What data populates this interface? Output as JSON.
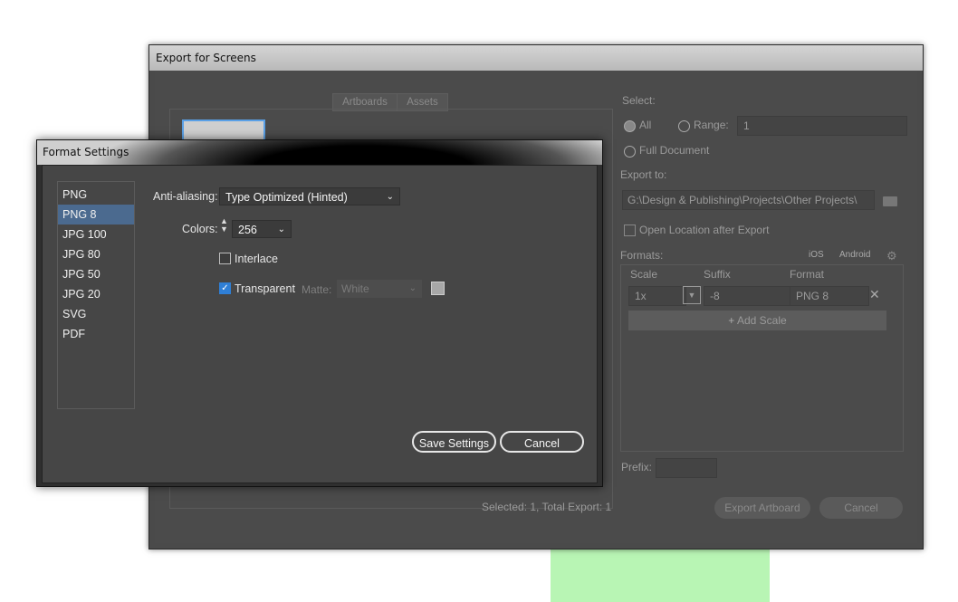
{
  "export_window": {
    "title": "Export for Screens",
    "tabs": [
      "Artboards",
      "Assets"
    ],
    "select_label": "Select:",
    "radio_all": "All",
    "radio_range": "Range:",
    "range_value": "1",
    "radio_full": "Full Document",
    "export_to_label": "Export to:",
    "export_path": "G:\\Design & Publishing\\Projects\\Other Projects\\",
    "open_location": "Open Location after Export",
    "formats_label": "Formats:",
    "ios": "iOS",
    "android": "Android",
    "col_scale": "Scale",
    "col_suffix": "Suffix",
    "col_format": "Format",
    "row_scale": "1x",
    "row_suffix": "-8",
    "row_format": "PNG 8",
    "add_scale": "Add Scale",
    "prefix_label": "Prefix:",
    "status": "Selected: 1, Total Export: 1",
    "export_button": "Export Artboard",
    "cancel_button": "Cancel"
  },
  "format_dialog": {
    "title": "Format Settings",
    "formats": [
      "PNG",
      "PNG 8",
      "JPG 100",
      "JPG 80",
      "JPG 50",
      "JPG 20",
      "SVG",
      "PDF"
    ],
    "selected_index": 1,
    "anti_aliasing_label": "Anti-aliasing:",
    "anti_aliasing_value": "Type Optimized (Hinted)",
    "colors_label": "Colors:",
    "colors_value": "256",
    "interlace_label": "Interlace",
    "interlace_checked": false,
    "transparent_label": "Transparent",
    "transparent_checked": true,
    "matte_label": "Matte:",
    "matte_value": "White",
    "save_button": "Save Settings",
    "cancel_button": "Cancel"
  },
  "colors": {
    "accent": "#4b6a8f",
    "checkbox": "#2f7fd6",
    "thumb_border": "#5aa0e6",
    "background_patch": "#b8f5b4"
  }
}
